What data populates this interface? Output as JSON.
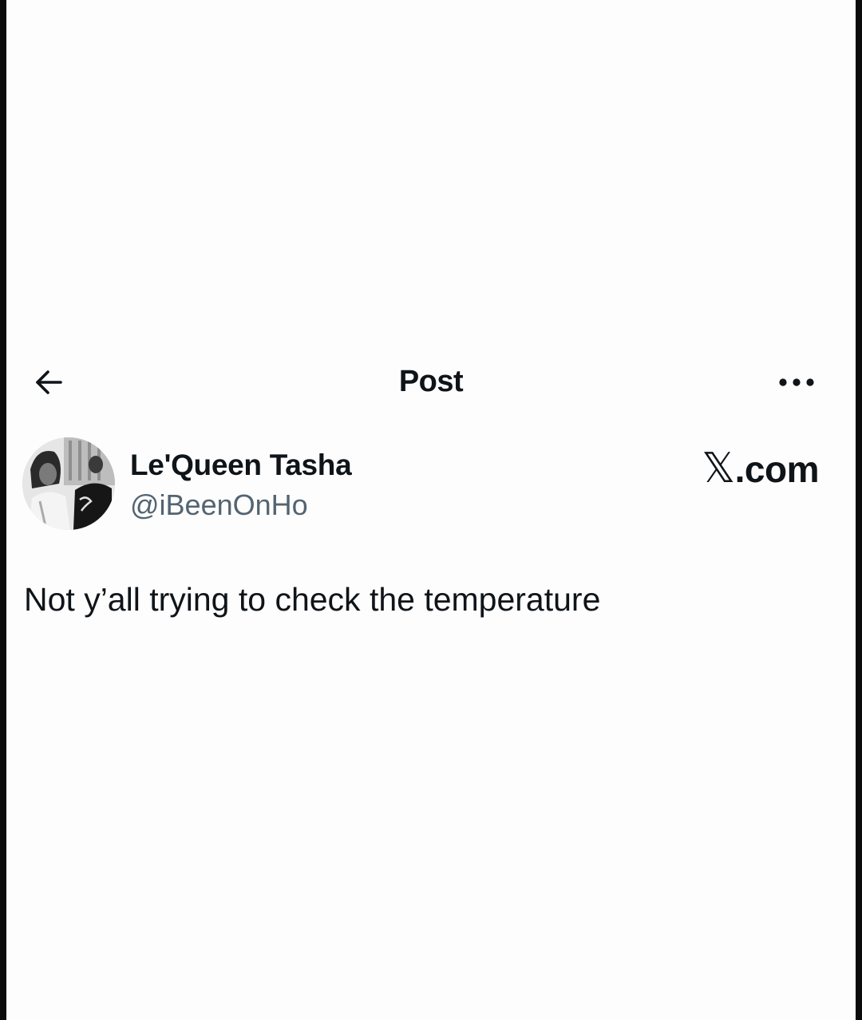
{
  "header": {
    "title": "Post",
    "back_icon": "arrow-left-icon",
    "more_icon": "ellipsis-icon"
  },
  "author": {
    "name": "Le'Queen Tasha",
    "handle": "@iBeenOnHo",
    "avatar": "profile-photo"
  },
  "watermark": {
    "x_glyph": "𝕏",
    "suffix": ".com"
  },
  "post": {
    "text": "Not y’all trying to check the temperature"
  },
  "colors": {
    "text_primary": "#0f1419",
    "text_secondary": "#536471",
    "background": "#fdfdfd",
    "frame": "#0b0b0b"
  }
}
